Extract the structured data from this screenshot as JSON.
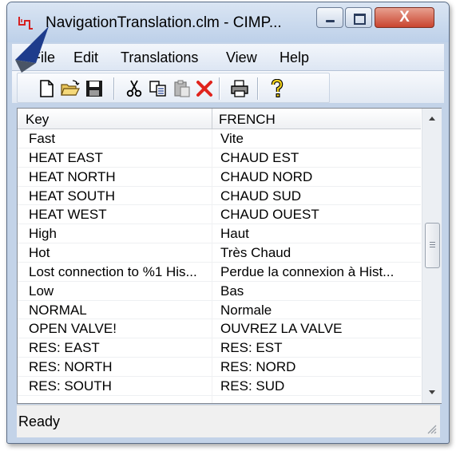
{
  "window": {
    "title": "NavigationTranslation.clm - CIMP...",
    "close_glyph": "X"
  },
  "menu": {
    "items": [
      {
        "label": "File"
      },
      {
        "label": "Edit"
      },
      {
        "label": "Translations"
      },
      {
        "label": "View"
      },
      {
        "label": "Help"
      }
    ]
  },
  "toolbar": {
    "icons": [
      "new-document-icon",
      "open-folder-icon",
      "save-disk-icon",
      "cut-icon",
      "copy-icon",
      "paste-icon",
      "delete-icon",
      "print-icon",
      "help-icon"
    ]
  },
  "table": {
    "columns": [
      "Key",
      "FRENCH"
    ],
    "rows": [
      [
        "Fast",
        "Vite"
      ],
      [
        "HEAT EAST",
        "CHAUD EST"
      ],
      [
        "HEAT NORTH",
        "CHAUD NORD"
      ],
      [
        "HEAT SOUTH",
        "CHAUD SUD"
      ],
      [
        "HEAT WEST",
        "CHAUD OUEST"
      ],
      [
        "High",
        "Haut"
      ],
      [
        "Hot",
        "Très Chaud"
      ],
      [
        "Lost connection to %1 His...",
        "Perdue la connexion à Hist..."
      ],
      [
        "Low",
        "Bas"
      ],
      [
        "NORMAL",
        "Normale"
      ],
      [
        "OPEN VALVE!",
        "OUVREZ LA VALVE"
      ],
      [
        "RES: EAST",
        "RES: EST"
      ],
      [
        "RES: NORTH",
        "RES: NORD"
      ],
      [
        "RES: SOUTH",
        "RES: SUD"
      ]
    ]
  },
  "status": {
    "text": "Ready"
  },
  "colors": {
    "close_button": "#c9452f",
    "arrow": "#1e3c8c",
    "app_icon": "#d62020"
  }
}
